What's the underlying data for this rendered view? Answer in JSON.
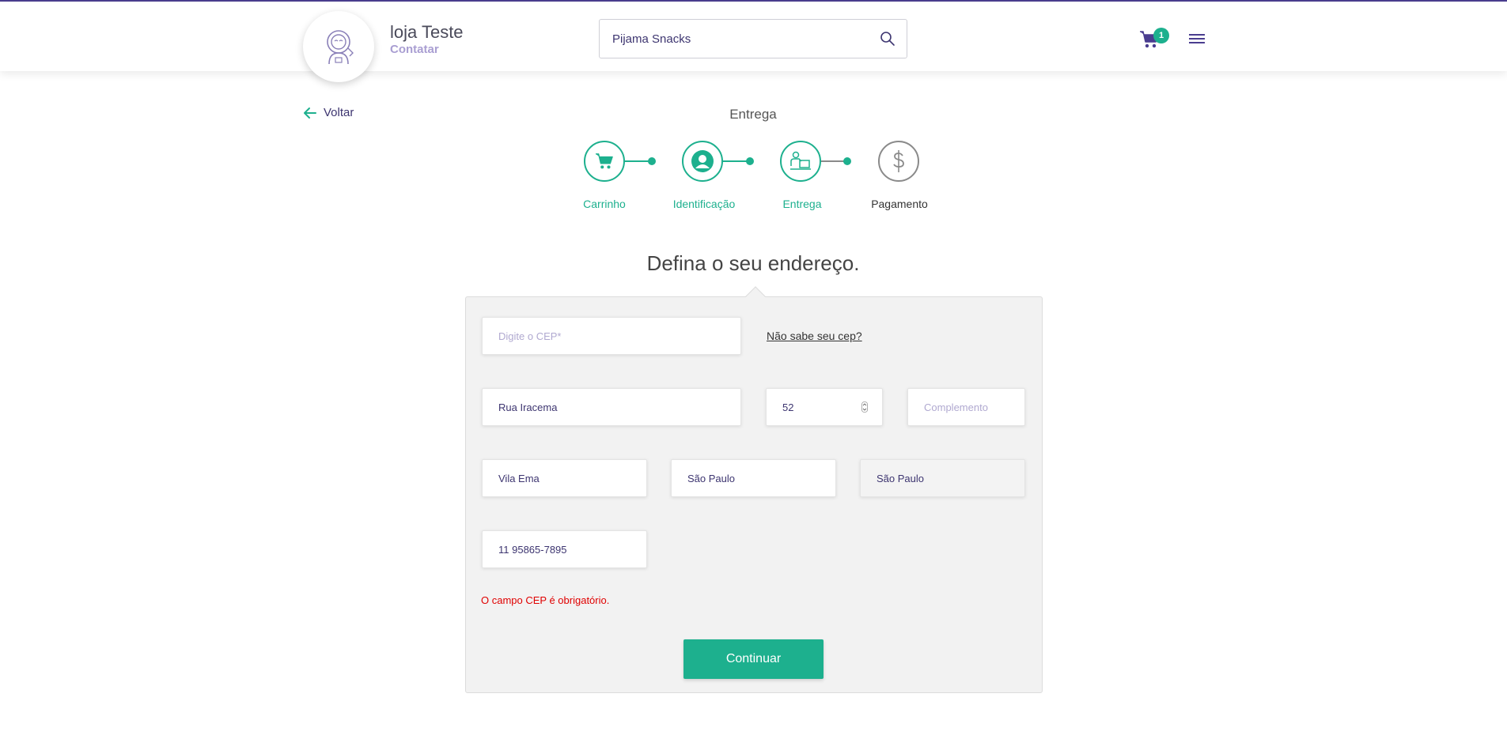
{
  "header": {
    "store_name": "loja Teste",
    "contact_label": "Contatar",
    "search_value": "Pijama Snacks",
    "cart_count": "1"
  },
  "nav": {
    "back_label": "Voltar",
    "step_title": "Entrega"
  },
  "steps": [
    {
      "label": "Carrinho",
      "status": "complete"
    },
    {
      "label": "Identificação",
      "status": "complete"
    },
    {
      "label": "Entrega",
      "status": "current"
    },
    {
      "label": "Pagamento",
      "status": "pending"
    }
  ],
  "form": {
    "heading": "Defina o seu endereço.",
    "cep_placeholder": "Digite o CEP*",
    "cep_help_link": "Não sabe seu cep?",
    "street_value": "Rua Iracema",
    "number_value": "52",
    "complement_placeholder": "Complemento",
    "neighborhood_value": "Vila Ema",
    "city_value": "São Paulo",
    "state_value": "São Paulo",
    "phone_value": "11 95865-7895",
    "error_message": "O campo CEP é obrigatório.",
    "continue_label": "Continuar"
  },
  "colors": {
    "accent": "#1db08e",
    "brand": "#4a3d8f",
    "error": "#e00000"
  }
}
